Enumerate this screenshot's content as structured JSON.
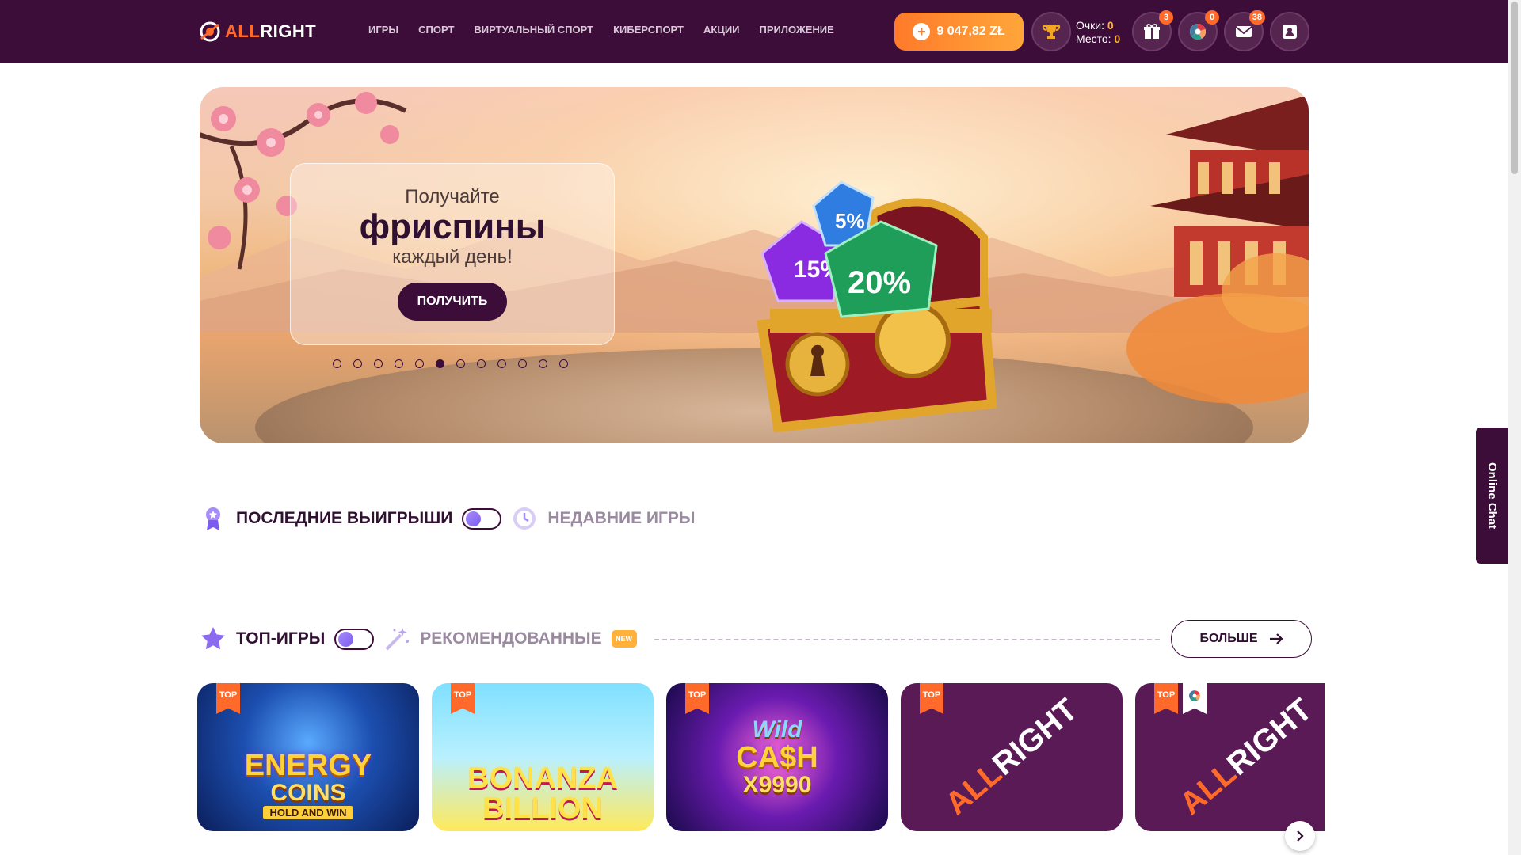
{
  "header": {
    "logo": {
      "all": "ALL",
      "right": "RIGHT"
    },
    "nav": [
      "ИГРЫ",
      "СПОРТ",
      "ВИРТУАЛЬНЫЙ СПОРТ",
      "КИБЕРСПОРТ",
      "АКЦИИ",
      "ПРИЛОЖЕНИЕ"
    ],
    "balance": "9 047,82 ZŁ",
    "score": {
      "points_label": "Очки:",
      "points_value": "0",
      "place_label": "Место:",
      "place_value": "0"
    },
    "badges": {
      "gifts": "3",
      "wheel": "0",
      "messages": "38"
    }
  },
  "hero": {
    "line1": "Получайте",
    "line2": "фриспины",
    "line3": "каждый день!",
    "button": "ПОЛУЧИТЬ",
    "slides_count": 12,
    "active_slide": 6,
    "chest_gems": [
      "15%",
      "5%",
      "20%"
    ]
  },
  "wins_section": {
    "title": "ПОСЛЕДНИЕ ВЫИГРЫШИ",
    "alt_title": "НЕДАВНИЕ ИГРЫ"
  },
  "games_section": {
    "title": "ТОП-ИГРЫ",
    "alt_title": "РЕКОМЕНДОВАННЫЕ",
    "new_badge": "NEW",
    "more_button": "БОЛЬШЕ",
    "top_label": "TOP",
    "games": [
      {
        "title_1": "ENERGY",
        "title_2": "COINS",
        "sub": "HOLD AND WIN"
      },
      {
        "title_1": "BONANZA",
        "title_2": "BILLION"
      },
      {
        "title_1": "Wild",
        "title_2": "CA$H",
        "sub": "X9990"
      },
      {
        "title_1": "ALL",
        "title_2": "RIGHT"
      },
      {
        "title_1": "ALL",
        "title_2": "RIGHT"
      }
    ]
  },
  "online_chat": "Online Chat",
  "colors": {
    "brand_dark": "#3d0d3a",
    "accent_orange": "#ff6a2a",
    "gold": "#ffb13a"
  }
}
